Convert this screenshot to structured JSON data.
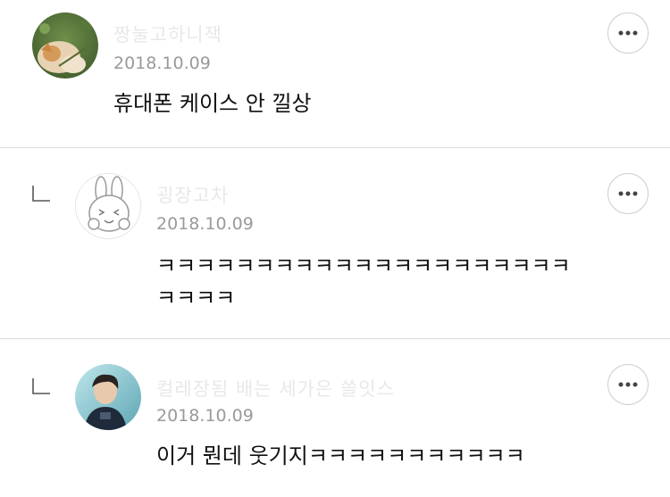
{
  "comments": [
    {
      "username": "짱눌고하니잭",
      "date": "2018.10.09",
      "text": "휴대폰 케이스 안 낄상",
      "avatar": "dog-photo-avatar",
      "is_reply": false
    },
    {
      "username": "굉장고차",
      "date": "2018.10.09",
      "text_lines": [
        "ㅋㅋㅋㅋㅋㅋㅋㅋㅋㅋㅋㅋㅋㅋㅋㅋㅋㅋㅋㅋㅋ",
        "ㅋㅋㅋㅋ"
      ],
      "avatar": "bunny-character-avatar",
      "is_reply": true
    },
    {
      "username": "컬레장됨 배는 세가은 쓸잇스",
      "date": "2018.10.09",
      "text": "이거 뭔데 웃기지ㅋㅋㅋㅋㅋㅋㅋㅋㅋㅋㅋ",
      "avatar": "person-photo-avatar",
      "is_reply": true
    }
  ],
  "colors": {
    "divider": "#dcdcdc",
    "date": "#9a9a9a",
    "username_blurred": "#e8e8e8",
    "text": "#111111",
    "button_border": "#cfcfcf"
  },
  "icons": {
    "more": "more-horizontal-icon",
    "reply": "reply-arrow-icon"
  }
}
